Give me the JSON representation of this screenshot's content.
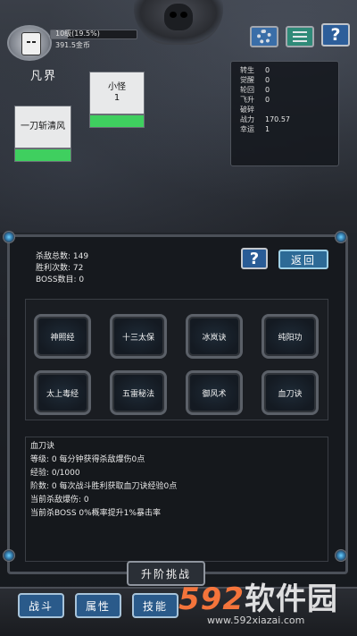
{
  "player": {
    "level_text": "10级(19.5%)",
    "level_progress": 0.195,
    "gold_text": "391.5金币",
    "realm": "凡界"
  },
  "stats": [
    {
      "k": "转生",
      "v": "0"
    },
    {
      "k": "觉醒",
      "v": "0"
    },
    {
      "k": "轮回",
      "v": "0"
    },
    {
      "k": "飞升",
      "v": "0"
    },
    {
      "k": "破碎",
      "v": ""
    },
    {
      "k": "战力",
      "v": "170.57"
    },
    {
      "k": "幸运",
      "v": "1"
    }
  ],
  "player_card": {
    "label": "一刀斩清风",
    "hp": 1.0
  },
  "monster_card": {
    "name": "小怪",
    "count": "1",
    "hp": 1.0
  },
  "kill_info": {
    "total_kills": "杀敌总数: 149",
    "wins": "胜利次数: 72",
    "boss": "BOSS数目: 0"
  },
  "buttons": {
    "help": "?",
    "back": "返回",
    "upgrade": "升阶挑战"
  },
  "skills": [
    "神照经",
    "十三太保",
    "冰岚诀",
    "纯阳功",
    "太上毒经",
    "五雷秘法",
    "御风术",
    "血刀诀"
  ],
  "desc": {
    "name": "血刀诀",
    "level": "等级: 0  每分钟获得杀敌爆伤0点",
    "exp": "经验: 0/1000",
    "rank": "阶数: 0  每次战斗胜利获取血刀诀经验0点",
    "crit": "当前杀敌爆伤: 0",
    "boss": "当前杀BOSS 0%概率提升1%暴击率"
  },
  "nav": [
    "战斗",
    "属性",
    "技能"
  ],
  "watermark": {
    "num": "592",
    "text": "软件园",
    "url": "www.592xiazai.com"
  }
}
